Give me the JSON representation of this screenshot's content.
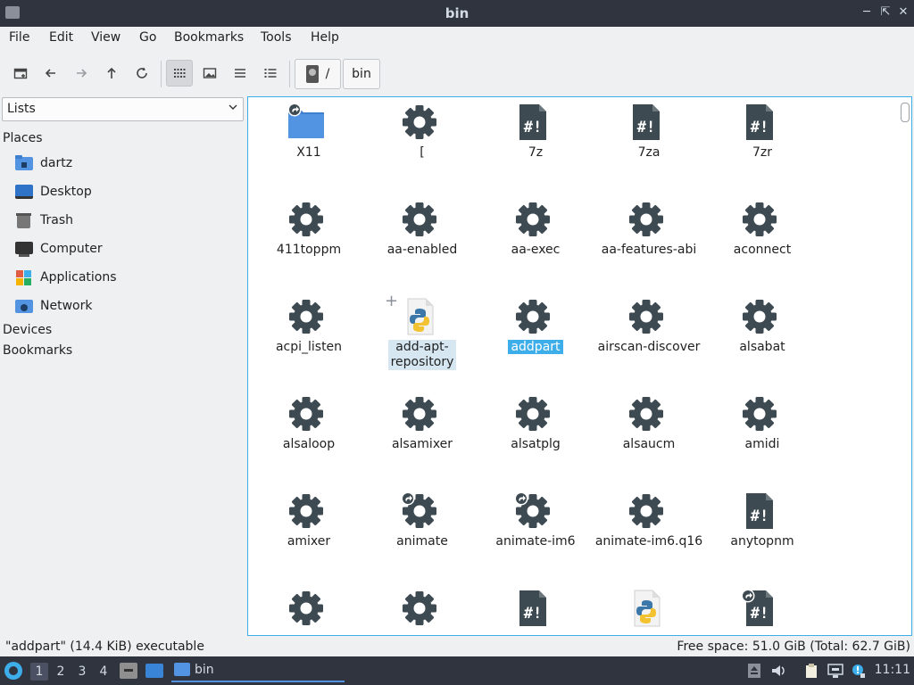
{
  "window": {
    "title": "bin"
  },
  "menu": [
    "File",
    "Edit",
    "View",
    "Go",
    "Bookmarks",
    "Tools",
    "Help"
  ],
  "path": {
    "root": "/",
    "current": "bin"
  },
  "sidebar": {
    "selector": "Lists",
    "places_heading": "Places",
    "places": [
      {
        "label": "dartz",
        "icon": "home-folder-icon"
      },
      {
        "label": "Desktop",
        "icon": "desktop-icon"
      },
      {
        "label": "Trash",
        "icon": "trash-icon"
      },
      {
        "label": "Computer",
        "icon": "computer-icon"
      },
      {
        "label": "Applications",
        "icon": "applications-icon"
      },
      {
        "label": "Network",
        "icon": "network-icon"
      }
    ],
    "devices_heading": "Devices",
    "bookmarks_heading": "Bookmarks"
  },
  "files": [
    {
      "label": "X11",
      "type": "folder-link"
    },
    {
      "label": "[",
      "type": "exec"
    },
    {
      "label": "7z",
      "type": "script"
    },
    {
      "label": "7za",
      "type": "script"
    },
    {
      "label": "7zr",
      "type": "script"
    },
    {
      "label": "411toppm",
      "type": "exec"
    },
    {
      "label": "aa-enabled",
      "type": "exec"
    },
    {
      "label": "aa-exec",
      "type": "exec"
    },
    {
      "label": "aa-features-abi",
      "type": "exec"
    },
    {
      "label": "aconnect",
      "type": "exec"
    },
    {
      "label": "acpi_listen",
      "type": "exec"
    },
    {
      "label": "add-apt-repository",
      "label_lines": [
        "add-apt-",
        "repository"
      ],
      "type": "python",
      "state": "hover"
    },
    {
      "label": "addpart",
      "type": "exec",
      "state": "selected"
    },
    {
      "label": "airscan-discover",
      "type": "exec"
    },
    {
      "label": "alsabat",
      "type": "exec"
    },
    {
      "label": "alsaloop",
      "type": "exec"
    },
    {
      "label": "alsamixer",
      "type": "exec"
    },
    {
      "label": "alsatplg",
      "type": "exec"
    },
    {
      "label": "alsaucm",
      "type": "exec"
    },
    {
      "label": "amidi",
      "type": "exec"
    },
    {
      "label": "amixer",
      "type": "exec"
    },
    {
      "label": "animate",
      "type": "exec-link"
    },
    {
      "label": "animate-im6",
      "type": "exec-link"
    },
    {
      "label": "animate-im6.q16",
      "type": "exec"
    },
    {
      "label": "anytopnm",
      "type": "script"
    },
    {
      "label": "",
      "type": "exec"
    },
    {
      "label": "",
      "type": "exec"
    },
    {
      "label": "",
      "type": "script"
    },
    {
      "label": "",
      "type": "python"
    },
    {
      "label": "",
      "type": "script-link"
    }
  ],
  "status": {
    "left": "\"addpart\" (14.4 KiB) executable",
    "right": "Free space: 51.0 GiB (Total: 62.7 GiB)"
  },
  "taskbar": {
    "workspaces": [
      "1",
      "2",
      "3",
      "4"
    ],
    "active_task": "bin",
    "clock": "11:11"
  },
  "colors": {
    "accent": "#3daee9",
    "panel": "#2f343f",
    "icon_dark": "#3e4a52",
    "folder": "#5294e2"
  }
}
